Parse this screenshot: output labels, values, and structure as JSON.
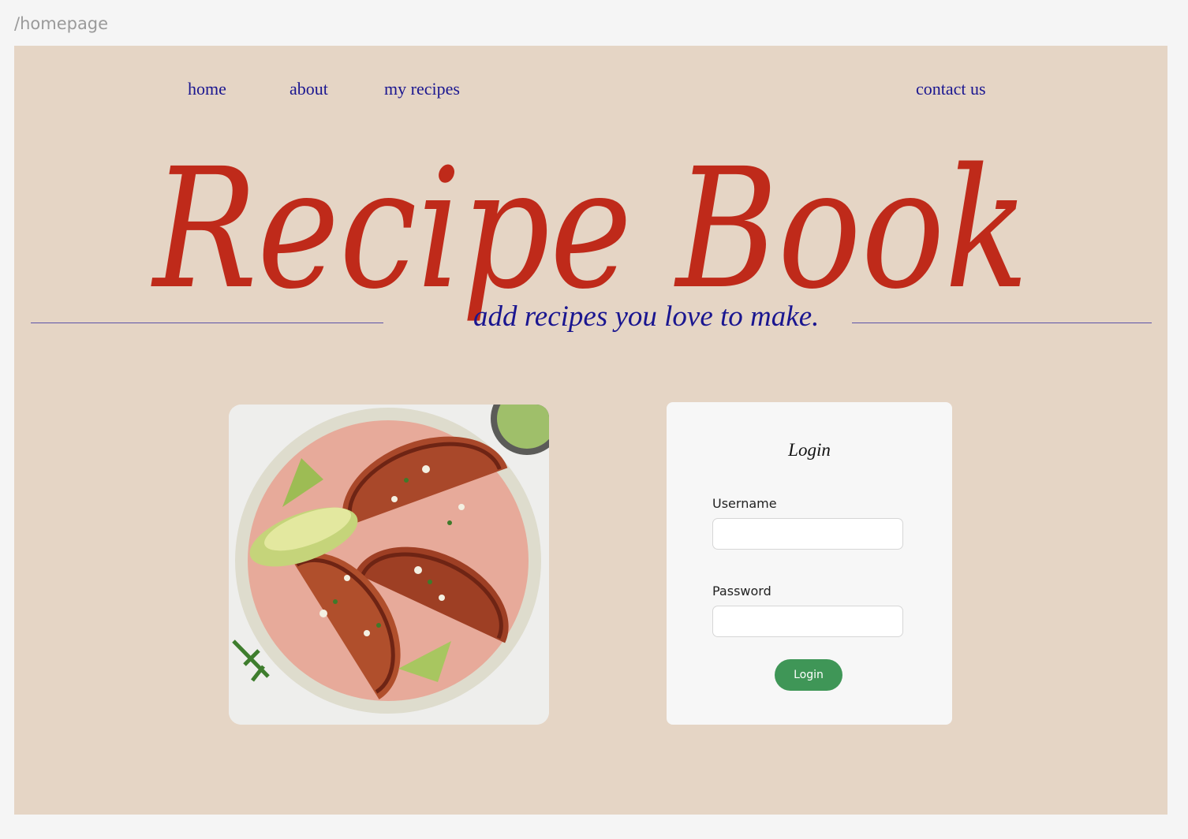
{
  "route": "/homepage",
  "nav": {
    "home": "home",
    "about": "about",
    "my_recipes": "my recipes",
    "contact": "contact us"
  },
  "hero": {
    "title": "Recipe Book",
    "tagline": "add recipes you love to make."
  },
  "login": {
    "title": "Login",
    "username_label": "Username",
    "username_value": "",
    "password_label": "Password",
    "password_value": "",
    "button_label": "Login"
  },
  "colors": {
    "background": "#f5f5f5",
    "frame": "#e5d5c5",
    "nav_text": "#1a1690",
    "title": "#bf2a1a",
    "card": "#f7f7f7",
    "button": "#3f9657"
  },
  "icons": {
    "food_image": "food-photo-tacos"
  }
}
